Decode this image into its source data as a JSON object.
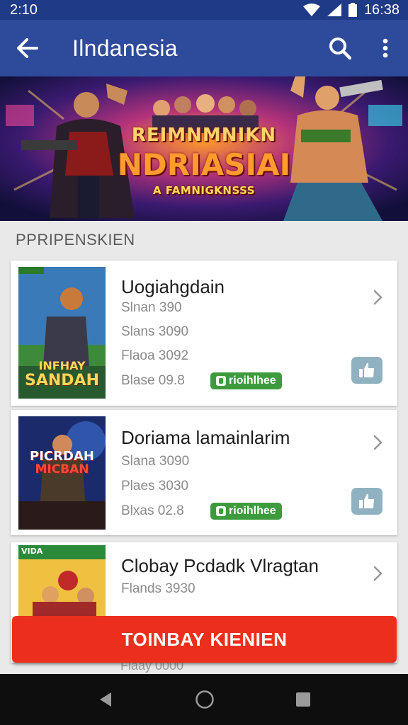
{
  "status_bar": {
    "time": "2:10",
    "clock": "16:38"
  },
  "app_bar": {
    "title": "Ilndanesia",
    "back_icon": "arrow-back-icon",
    "search_icon": "search-icon",
    "more_icon": "more-vert-icon"
  },
  "banner": {
    "line1": "REIMNMNIKN",
    "line2": "NDRIASIAI",
    "line3": "A FAMNIGKNSSS"
  },
  "section": {
    "label": "PPRIPENSKIEN"
  },
  "cards": [
    {
      "name": "Uogiahgdain",
      "lines": [
        "Slnan 390",
        "Slans 3090",
        "Flaoa 3092"
      ],
      "rating": "Blase 09.8",
      "tag": "rioihlhee",
      "thumb_title_1": "INFHAY",
      "thumb_title_2": "SANDAH"
    },
    {
      "name": "Doriama lamainlarim",
      "lines": [
        "Slana 3090",
        "Plaes 3030"
      ],
      "rating": "Blxas 02.8",
      "tag": "rioihlhee",
      "thumb_title_1": "PICRDAH",
      "thumb_title_2": "MICBAN"
    },
    {
      "name": "Clobay Pcdadk Vlragtan",
      "lines": [
        "Flands 3930"
      ],
      "thumb_title_1": "VIDA"
    }
  ],
  "peek": {
    "text": "Flaay 0000"
  },
  "cta": {
    "label": "TOINBAY KIENIEN"
  },
  "colors": {
    "status_bar": "#1f3a86",
    "app_bar": "#2e4a9a",
    "cta": "#ec2f1c",
    "tag": "#3d9b3d",
    "like": "#90b2c0"
  }
}
